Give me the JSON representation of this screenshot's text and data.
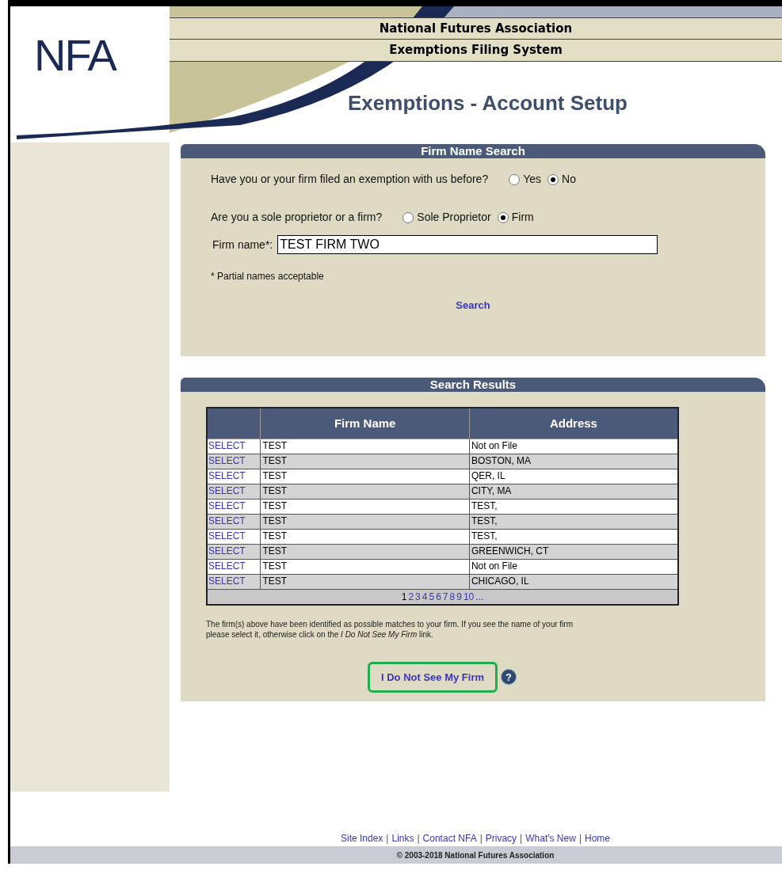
{
  "header": {
    "logo": "NFA",
    "org_title": "National Futures Association",
    "system_title": "Exemptions Filing System"
  },
  "page_title": "Exemptions - Account Setup",
  "search_panel": {
    "title": "Firm Name Search",
    "questions": [
      {
        "label": "Have you or your firm filed an exemption with us before?",
        "options": [
          {
            "label": "Yes",
            "selected": false
          },
          {
            "label": "No",
            "selected": true
          }
        ]
      },
      {
        "label": "Are you a sole proprietor or a firm?",
        "options": [
          {
            "label": "Sole Proprietor",
            "selected": false
          },
          {
            "label": "Firm",
            "selected": true
          }
        ]
      }
    ],
    "firm_name": {
      "label": "Firm name*:",
      "value": "TEST FIRM TWO"
    },
    "note": "* Partial names acceptable",
    "search_link": "Search"
  },
  "results_panel": {
    "title": "Search Results",
    "table": {
      "columns": [
        "Firm Name",
        "Address"
      ],
      "rows": [
        {
          "action": "SELECT",
          "firm_name": "TEST",
          "address": "Not on File"
        },
        {
          "action": "SELECT",
          "firm_name": "TEST",
          "address": "BOSTON, MA"
        },
        {
          "action": "SELECT",
          "firm_name": "TEST",
          "address": "QER, IL"
        },
        {
          "action": "SELECT",
          "firm_name": "TEST",
          "address": "CITY, MA"
        },
        {
          "action": "SELECT",
          "firm_name": "TEST",
          "address": "TEST,"
        },
        {
          "action": "SELECT",
          "firm_name": "TEST",
          "address": "TEST,"
        },
        {
          "action": "SELECT",
          "firm_name": "TEST",
          "address": "TEST,"
        },
        {
          "action": "SELECT",
          "firm_name": "TEST",
          "address": "GREENWICH, CT"
        },
        {
          "action": "SELECT",
          "firm_name": "TEST",
          "address": "Not on File"
        },
        {
          "action": "SELECT",
          "firm_name": "TEST",
          "address": "CHICAGO, IL"
        }
      ],
      "pagination": [
        {
          "label": "1",
          "selected": true
        },
        {
          "label": "2",
          "selected": false
        },
        {
          "label": "3",
          "selected": false
        },
        {
          "label": "4",
          "selected": false
        },
        {
          "label": "5",
          "selected": false
        },
        {
          "label": "6",
          "selected": false
        },
        {
          "label": "7",
          "selected": false
        },
        {
          "label": "8",
          "selected": false
        },
        {
          "label": "9",
          "selected": false
        },
        {
          "label": "10",
          "selected": false
        },
        {
          "label": "...",
          "selected": false
        }
      ]
    },
    "note": "The firm(s) above have been identified as possible matches to your firm. If you see the name of your firm please select it, otherwise click on the *I Do Not See My Firm* link.",
    "no_firm_link": {
      "label": "I Do Not See My Firm",
      "highlighted": true
    },
    "help_icon": "?"
  },
  "footer": {
    "links": [
      {
        "kind": "link",
        "text": "Site Index"
      },
      {
        "kind": "separator",
        "text": "|"
      },
      {
        "kind": "link",
        "text": "Links"
      },
      {
        "kind": "separator",
        "text": "|"
      },
      {
        "kind": "link",
        "text": "Contact NFA"
      },
      {
        "kind": "separator",
        "text": "|"
      },
      {
        "kind": "link",
        "text": "Privacy"
      },
      {
        "kind": "separator",
        "text": "|"
      },
      {
        "kind": "link",
        "text": "What's New"
      },
      {
        "kind": "separator",
        "text": "|"
      },
      {
        "kind": "link",
        "text": "Home"
      }
    ],
    "copyright": "© 2003-2018 National Futures Association"
  }
}
